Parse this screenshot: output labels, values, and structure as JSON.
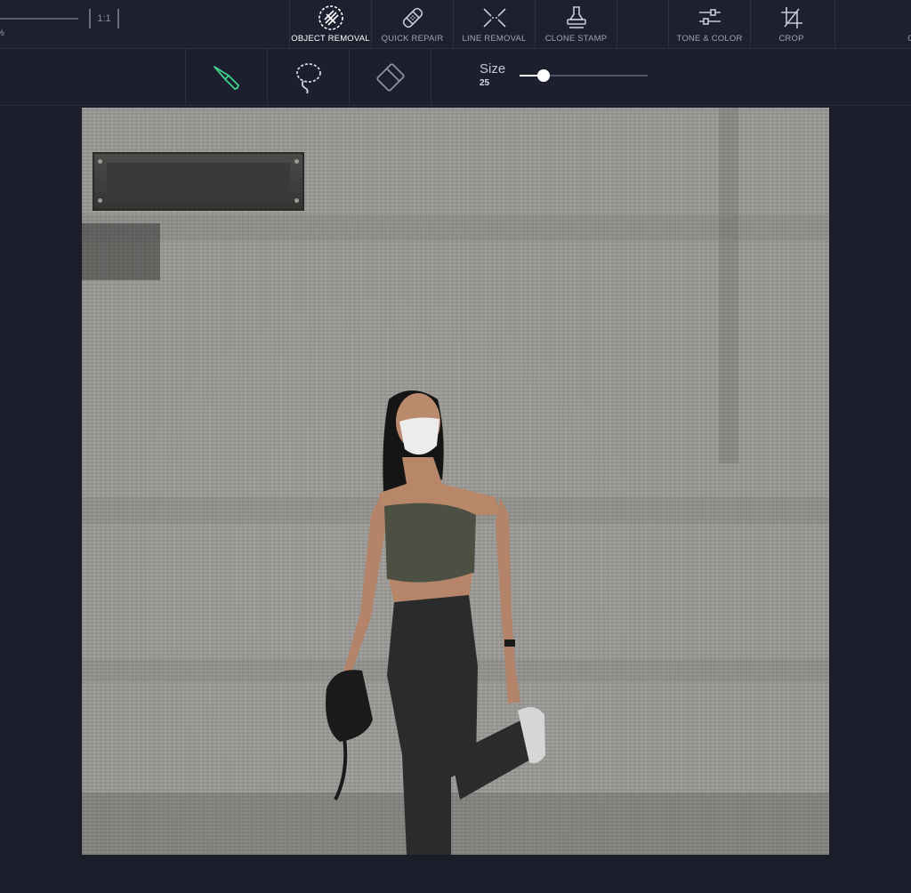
{
  "toolbar": {
    "zoom_label": "%",
    "fit_label": "1:1",
    "tools": [
      {
        "label": "OBJECT REMOVAL",
        "icon": "object-removal-icon",
        "active": true
      },
      {
        "label": "QUICK REPAIR",
        "icon": "bandage-icon",
        "active": false
      },
      {
        "label": "LINE REMOVAL",
        "icon": "line-removal-icon",
        "active": false
      },
      {
        "label": "CLONE STAMP",
        "icon": "stamp-icon",
        "active": false
      },
      {
        "label": "TONE & COLOR",
        "icon": "sliders-icon",
        "active": false
      },
      {
        "label": "CROP",
        "icon": "crop-icon",
        "active": false
      }
    ],
    "cut_label": "C"
  },
  "brush_panel": {
    "size_label": "Size",
    "size_value": "25",
    "size_fraction": 0.19,
    "accent_color": "#3fd18a",
    "tools": [
      {
        "name": "brush",
        "icon": "brush-icon",
        "active": true
      },
      {
        "name": "lasso",
        "icon": "lasso-icon",
        "active": false
      },
      {
        "name": "eraser",
        "icon": "eraser-icon",
        "active": false
      }
    ]
  }
}
